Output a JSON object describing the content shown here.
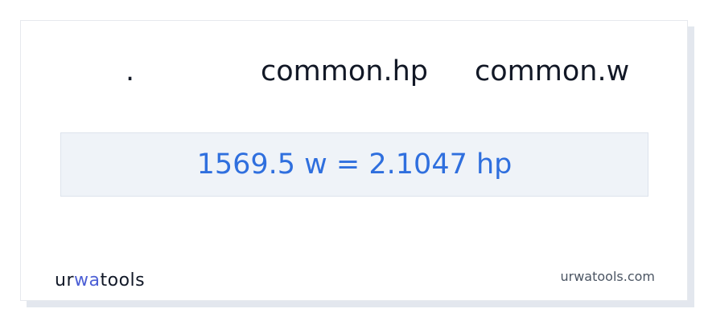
{
  "header": {
    "col1": ".",
    "col2": "common.hp",
    "col3": "common.w"
  },
  "result": {
    "text": "1569.5 w = 2.1047 hp"
  },
  "brand": {
    "logo_part1": "ur",
    "logo_part2": "wa",
    "logo_part3": "tools",
    "accent_color": "#4c5fd5"
  },
  "footer": {
    "site": "urwatools.com"
  },
  "colors": {
    "result_text": "#2f6fde",
    "result_bg": "#eff3f8"
  }
}
